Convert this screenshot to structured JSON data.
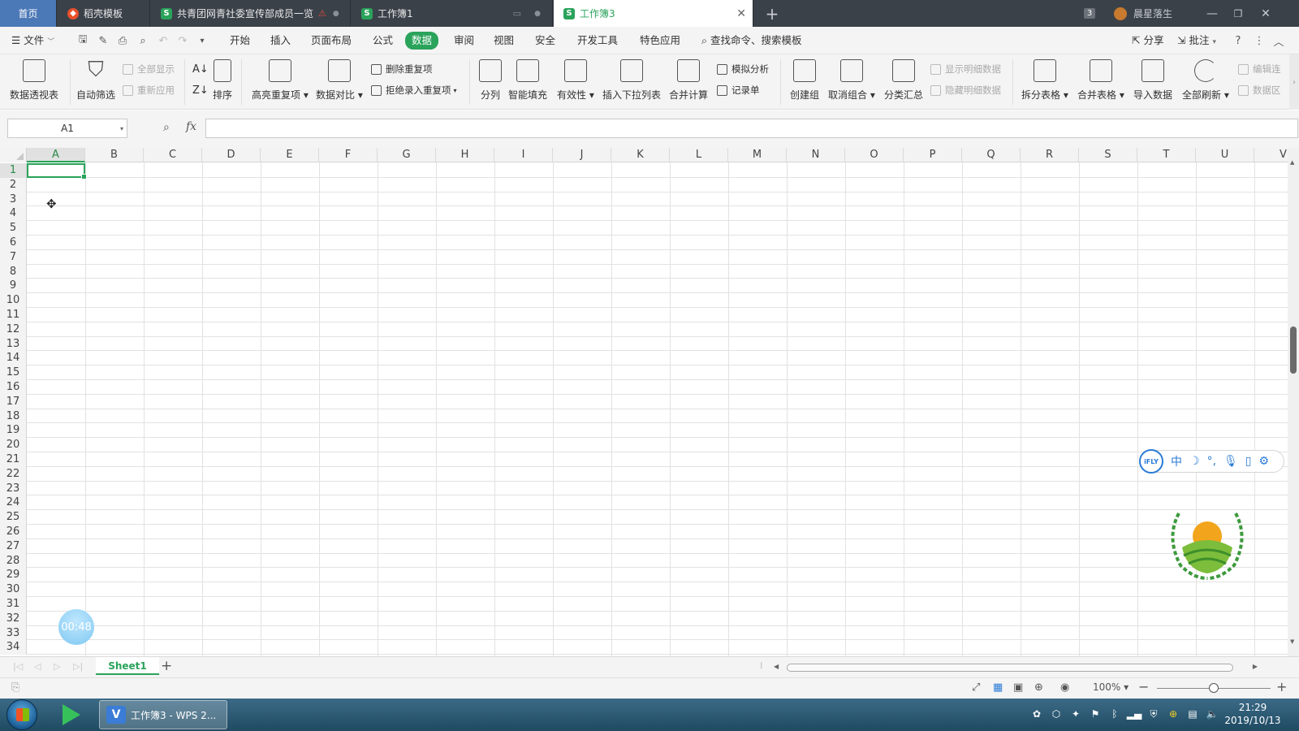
{
  "tabs": {
    "home": "首页",
    "templates": "稻壳模板",
    "doc1": "共青团网青社委宣传部成员一览",
    "doc2": "工作簿1",
    "doc3": "工作簿3",
    "new_tab": "+",
    "window_count": "3",
    "user": "晨星落生"
  },
  "menu": {
    "file": "文件",
    "items": [
      "开始",
      "插入",
      "页面布局",
      "公式",
      "数据",
      "审阅",
      "视图",
      "安全",
      "开发工具",
      "特色应用"
    ],
    "active": "数据",
    "search": "查找命令、搜索模板",
    "share": "分享",
    "comment": "批注"
  },
  "ribbon": {
    "pivot": "数据透视表",
    "autofilter": "自动筛选",
    "show_all": "全部显示",
    "reapply": "重新应用",
    "sort": "排序",
    "highlight_dup": "高亮重复项",
    "data_compare": "数据对比",
    "remove_dup": "删除重复项",
    "reject_dup": "拒绝录入重复项",
    "split_col": "分列",
    "smart_fill": "智能填充",
    "validity": "有效性",
    "insert_dropdown": "插入下拉列表",
    "consolidate": "合并计算",
    "what_if": "模拟分析",
    "record_form": "记录单",
    "group": "创建组",
    "ungroup": "取消组合",
    "subtotal": "分类汇总",
    "show_detail": "显示明细数据",
    "hide_detail": "隐藏明细数据",
    "split_table": "拆分表格",
    "merge_table": "合并表格",
    "import_data": "导入数据",
    "refresh_all": "全部刷新",
    "edit_links": "编辑连",
    "data_region": "数据区"
  },
  "formula_bar": {
    "cell_ref": "A1",
    "fx": "fx",
    "value": ""
  },
  "grid": {
    "columns": [
      "A",
      "B",
      "C",
      "D",
      "E",
      "F",
      "G",
      "H",
      "I",
      "J",
      "K",
      "L",
      "M",
      "N",
      "O",
      "P",
      "Q",
      "R",
      "S",
      "T",
      "U",
      "V"
    ],
    "rows": [
      "1",
      "2",
      "3",
      "4",
      "5",
      "6",
      "7",
      "8",
      "9",
      "10",
      "11",
      "12",
      "13",
      "14",
      "15",
      "16",
      "17",
      "18",
      "19",
      "20",
      "21",
      "22",
      "23",
      "24",
      "25",
      "26",
      "27",
      "28",
      "29",
      "30",
      "31",
      "32",
      "33",
      "34"
    ],
    "active_cell": "A1"
  },
  "sheets": {
    "names": [
      "Sheet1"
    ],
    "add": "+"
  },
  "status": {
    "zoom": "100%",
    "zoom_fraction": 0.5
  },
  "overlays": {
    "timer": "00:48",
    "ifly_logo": "iFLY",
    "ifly_lang": "中"
  },
  "taskbar": {
    "app": "工作簿3 - WPS 2...",
    "time": "21:29",
    "date": "2019/10/13"
  },
  "colors": {
    "accent": "#2aa35b",
    "tabbar": "#3b4149",
    "home_tab": "#4b78b6"
  }
}
